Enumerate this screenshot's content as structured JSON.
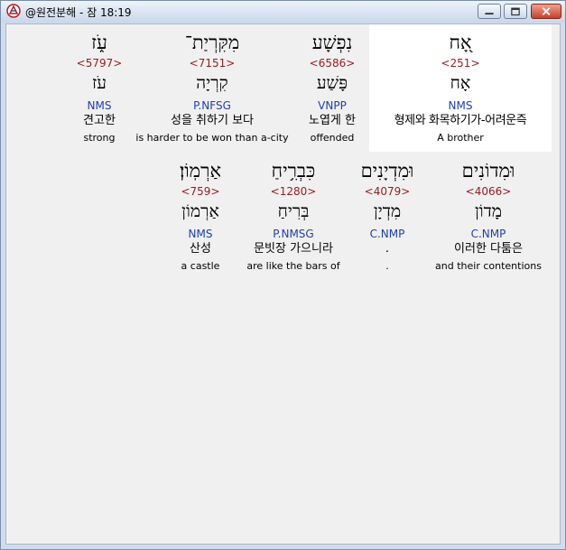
{
  "window": {
    "title": "@원전분해 - 잠 18:19"
  },
  "rows": [
    {
      "words": [
        {
          "hebrew": "עֹ֑ז",
          "strong": "<5797>",
          "lemma": "עֹז",
          "parse": "NMS",
          "korean": "견고한",
          "english": "strong"
        },
        {
          "hebrew": "מִקִּרְיַת־",
          "strong": "<7151>",
          "lemma": "קִרְיָה",
          "parse": "P.NFSG",
          "korean": "성을 취하기 보다",
          "english": "is harder to be won than a-city"
        },
        {
          "hebrew": "נִפְשָׁע",
          "strong": "<6586>",
          "lemma": "פָּשַׁע",
          "parse": "VNPP",
          "korean": "노엽게 한",
          "english": "offended"
        },
        {
          "hebrew": "אָ֭ח",
          "strong": "<251>",
          "lemma": "אָח",
          "parse": "NMS",
          "korean": "형제와 화목하기가-어려운즉",
          "english": "A brother"
        }
      ]
    },
    {
      "words": [
        {
          "hebrew": "אַרְמֽוֹן׃",
          "strong": "<759>",
          "lemma": "אַרְמוֹן",
          "parse": "NMS",
          "korean": "산성",
          "english": "a castle"
        },
        {
          "hebrew": "כִּבְרִ֥יחַ",
          "strong": "<1280>",
          "lemma": "בְּרִיחַ",
          "parse": "P.NMSG",
          "korean": "문빗장 가으니라",
          "english": "are like the bars of"
        },
        {
          "hebrew": "וּמִדְיָנִים",
          "strong": "<4079>",
          "lemma": "מִדְיָן",
          "parse": "C.NMP",
          "korean": ".",
          "english": "."
        },
        {
          "hebrew": "וּמִדוֹנִים",
          "strong": "<4066>",
          "lemma": "מָדוֹן",
          "parse": "C.NMP",
          "korean": "이러한 다툼은",
          "english": "and their contentions"
        }
      ]
    }
  ]
}
